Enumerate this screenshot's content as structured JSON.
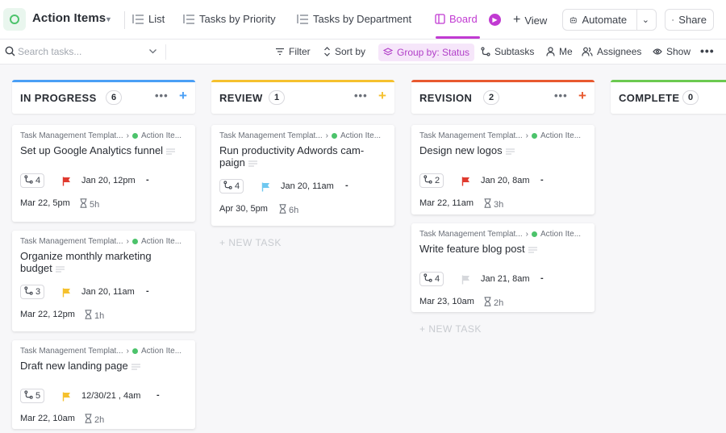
{
  "header": {
    "title": "Action Items",
    "tabs": [
      {
        "label": "List"
      },
      {
        "label": "Tasks by Priority"
      },
      {
        "label": "Tasks by Department"
      },
      {
        "label": "Board"
      }
    ],
    "add_view_label": "View",
    "automate_label": "Automate",
    "share_label": "Share",
    "accent_color": "#c13ad2"
  },
  "toolbar": {
    "search_placeholder": "Search tasks...",
    "filter_label": "Filter",
    "sort_label": "Sort by",
    "group_label": "Group by: Status",
    "subtasks_label": "Subtasks",
    "me_label": "Me",
    "assignees_label": "Assignees",
    "show_label": "Show"
  },
  "columns": [
    {
      "name": "IN PROGRESS",
      "count": "6",
      "color": "#4a9ff5",
      "cards": [
        {
          "crumb_list": "Task Management Templat...",
          "crumb_status": "Action Ite...",
          "title": "Set up Google Analytics funnel",
          "subtasks": "4",
          "priority": "urgent",
          "priority_color": "#e03a2f",
          "due_start": "Jan 20, 12pm",
          "due_end": "Mar 22, 5pm",
          "estimate": "5h"
        },
        {
          "crumb_list": "Task Management Templat...",
          "crumb_status": "Action Ite...",
          "title": "Organize monthly marketing budget",
          "subtasks": "3",
          "priority": "high",
          "priority_color": "#f5c12e",
          "due_start": "Jan 20, 11am",
          "due_end": "Mar 22, 12pm",
          "estimate": "1h"
        },
        {
          "crumb_list": "Task Management Templat...",
          "crumb_status": "Action Ite...",
          "title": "Draft new landing page",
          "subtasks": "5",
          "priority": "high",
          "priority_color": "#f5c12e",
          "due_start": "12/30/21 , 4am",
          "due_end": "Mar 22, 10am",
          "estimate": "2h"
        }
      ]
    },
    {
      "name": "REVIEW",
      "count": "1",
      "color": "#f5c12e",
      "new_task_label": "+ NEW TASK",
      "cards": [
        {
          "crumb_list": "Task Management Templat...",
          "crumb_status": "Action Ite...",
          "title": "Run productivity Adwords cam-paign",
          "subtasks": "4",
          "priority": "normal",
          "priority_color": "#6fc8f0",
          "due_start": "Jan 20, 11am",
          "due_end": "Apr 30, 5pm",
          "estimate": "6h"
        }
      ]
    },
    {
      "name": "REVISION",
      "count": "2",
      "color": "#e8592f",
      "new_task_label": "+ NEW TASK",
      "cards": [
        {
          "crumb_list": "Task Management Templat...",
          "crumb_status": "Action Ite...",
          "title": "Design new logos",
          "subtasks": "2",
          "priority": "urgent",
          "priority_color": "#e03a2f",
          "due_start": "Jan 20, 8am",
          "due_end": "Mar 22, 11am",
          "estimate": "3h"
        },
        {
          "crumb_list": "Task Management Templat...",
          "crumb_status": "Action Ite...",
          "title": "Write feature blog post",
          "subtasks": "4",
          "priority": "low",
          "priority_color": "#d6d8dc",
          "due_start": "Jan 21, 8am",
          "due_end": "Mar 23, 10am",
          "estimate": "2h"
        }
      ]
    },
    {
      "name": "COMPLETE",
      "count": "0",
      "color": "#6bc950",
      "cards": []
    }
  ]
}
